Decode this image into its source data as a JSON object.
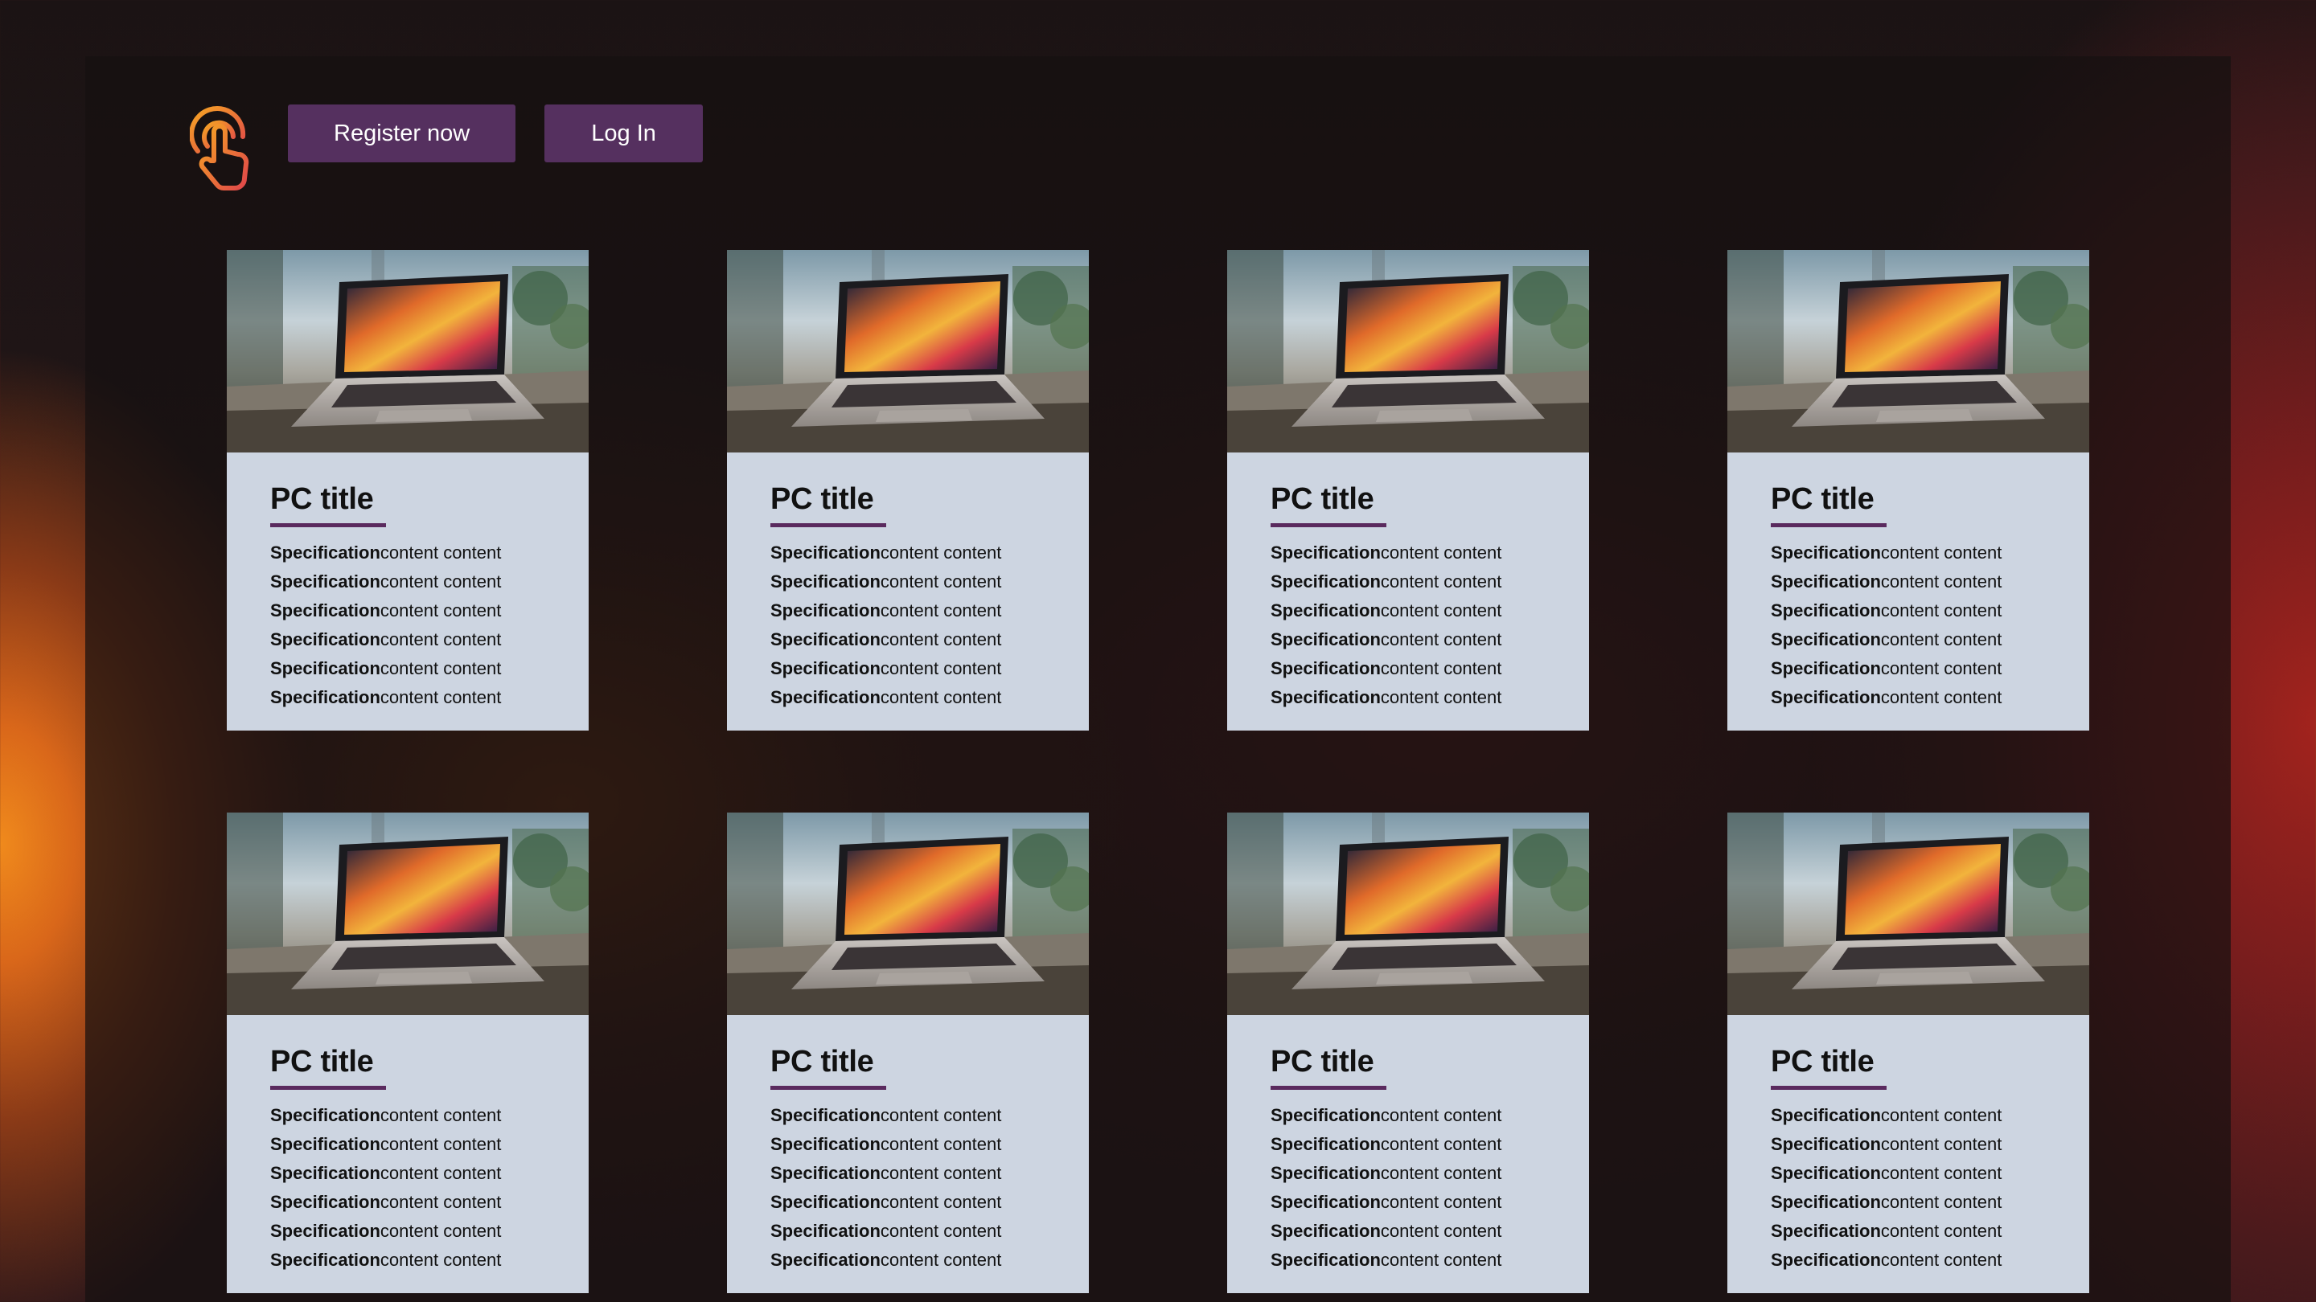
{
  "header": {
    "logo": "touch-hand-icon",
    "register_label": "Register now",
    "login_label": "Log In"
  },
  "colors": {
    "button": "#55305f",
    "card_bg": "#cdd5e1",
    "underline": "#5a2a5e",
    "logo_gradient": [
      "#f6a623",
      "#e0464a"
    ]
  },
  "cards": [
    {
      "title": "PC title",
      "specs": [
        {
          "label": "Specification",
          "value": "content content"
        },
        {
          "label": "Specification",
          "value": "content content"
        },
        {
          "label": "Specification",
          "value": "content content"
        },
        {
          "label": "Specification",
          "value": "content content"
        },
        {
          "label": "Specification",
          "value": "content content"
        },
        {
          "label": "Specification",
          "value": "content content"
        }
      ]
    },
    {
      "title": "PC title",
      "specs": [
        {
          "label": "Specification",
          "value": "content content"
        },
        {
          "label": "Specification",
          "value": "content content"
        },
        {
          "label": "Specification",
          "value": "content content"
        },
        {
          "label": "Specification",
          "value": "content content"
        },
        {
          "label": "Specification",
          "value": "content content"
        },
        {
          "label": "Specification",
          "value": "content content"
        }
      ]
    },
    {
      "title": "PC title",
      "specs": [
        {
          "label": "Specification",
          "value": "content content"
        },
        {
          "label": "Specification",
          "value": "content content"
        },
        {
          "label": "Specification",
          "value": "content content"
        },
        {
          "label": "Specification",
          "value": "content content"
        },
        {
          "label": "Specification",
          "value": "content content"
        },
        {
          "label": "Specification",
          "value": "content content"
        }
      ]
    },
    {
      "title": "PC title",
      "specs": [
        {
          "label": "Specification",
          "value": "content content"
        },
        {
          "label": "Specification",
          "value": "content content"
        },
        {
          "label": "Specification",
          "value": "content content"
        },
        {
          "label": "Specification",
          "value": "content content"
        },
        {
          "label": "Specification",
          "value": "content content"
        },
        {
          "label": "Specification",
          "value": "content content"
        }
      ]
    },
    {
      "title": "PC title",
      "specs": [
        {
          "label": "Specification",
          "value": "content content"
        },
        {
          "label": "Specification",
          "value": "content content"
        },
        {
          "label": "Specification",
          "value": "content content"
        },
        {
          "label": "Specification",
          "value": "content content"
        },
        {
          "label": "Specification",
          "value": "content content"
        },
        {
          "label": "Specification",
          "value": "content content"
        }
      ]
    },
    {
      "title": "PC title",
      "specs": [
        {
          "label": "Specification",
          "value": "content content"
        },
        {
          "label": "Specification",
          "value": "content content"
        },
        {
          "label": "Specification",
          "value": "content content"
        },
        {
          "label": "Specification",
          "value": "content content"
        },
        {
          "label": "Specification",
          "value": "content content"
        },
        {
          "label": "Specification",
          "value": "content content"
        }
      ]
    },
    {
      "title": "PC title",
      "specs": [
        {
          "label": "Specification",
          "value": "content content"
        },
        {
          "label": "Specification",
          "value": "content content"
        },
        {
          "label": "Specification",
          "value": "content content"
        },
        {
          "label": "Specification",
          "value": "content content"
        },
        {
          "label": "Specification",
          "value": "content content"
        },
        {
          "label": "Specification",
          "value": "content content"
        }
      ]
    },
    {
      "title": "PC title",
      "specs": [
        {
          "label": "Specification",
          "value": "content content"
        },
        {
          "label": "Specification",
          "value": "content content"
        },
        {
          "label": "Specification",
          "value": "content content"
        },
        {
          "label": "Specification",
          "value": "content content"
        },
        {
          "label": "Specification",
          "value": "content content"
        },
        {
          "label": "Specification",
          "value": "content content"
        }
      ]
    }
  ]
}
